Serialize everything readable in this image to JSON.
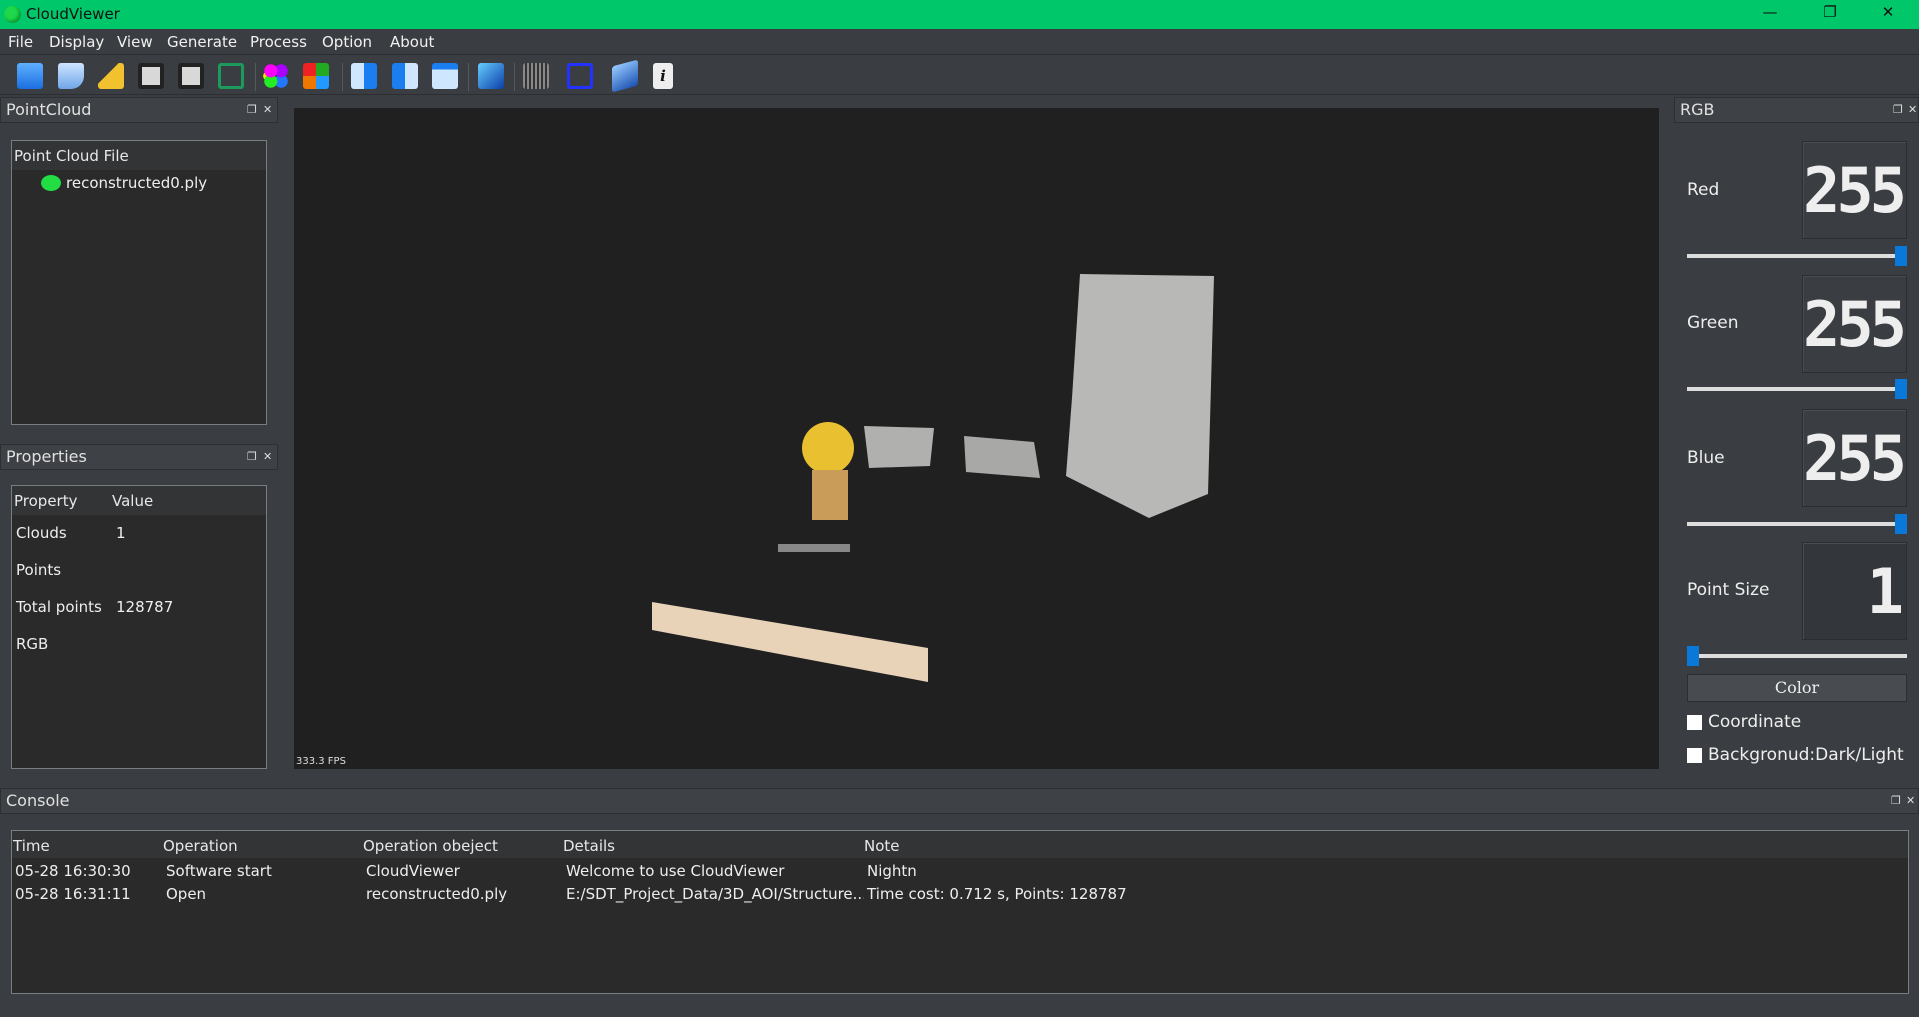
{
  "app": {
    "title": "CloudViewer",
    "accent": "#00c86a"
  },
  "menu": [
    "File",
    "Display",
    "View",
    "Generate",
    "Process",
    "Option",
    "About"
  ],
  "toolbar": {
    "icons": [
      "open-file-icon",
      "add-file-icon",
      "clear-broom-icon",
      "save-icon",
      "save-as-icon",
      "crop-icon",
      "color-palette-icon",
      "color-fill-icon",
      "view-front-icon",
      "view-side-icon",
      "view-top-icon",
      "view-iso-icon",
      "mesh-grid-icon",
      "bounding-box-icon",
      "help-book-icon",
      "info-icon"
    ]
  },
  "pointcloud": {
    "title": "PointCloud",
    "header": "Point Cloud File",
    "files": [
      "reconstructed0.ply"
    ]
  },
  "properties": {
    "title": "Properties",
    "columns": [
      "Property",
      "Value"
    ],
    "rows": [
      [
        "Clouds",
        "1"
      ],
      [
        "Points",
        ""
      ],
      [
        "Total points",
        "128787"
      ],
      [
        "RGB",
        ""
      ]
    ]
  },
  "viewport": {
    "fps": "333.3 FPS"
  },
  "rgb": {
    "title": "RGB",
    "red": {
      "label": "Red",
      "value": "255",
      "fraction": 1
    },
    "green": {
      "label": "Green",
      "value": "255",
      "fraction": 1
    },
    "blue": {
      "label": "Blue",
      "value": "255",
      "fraction": 1
    },
    "point_size": {
      "label": "Point Size",
      "value": "1",
      "fraction": 0
    },
    "color_button": "Color",
    "coordinate": "Coordinate",
    "background": "Backgronud:Dark/Light"
  },
  "console": {
    "title": "Console",
    "columns": [
      "Time",
      "Operation",
      "Operation obeject",
      "Details",
      "Note"
    ],
    "rows": [
      [
        "05-28 16:30:30",
        "Software start",
        "CloudViewer",
        "Welcome to use CloudViewer",
        "Nightn"
      ],
      [
        "05-28 16:31:11",
        "Open",
        "reconstructed0.ply",
        "E:/SDT_Project_Data/3D_AOI/Structure...",
        "Time cost: 0.712 s, Points: 128787"
      ]
    ]
  }
}
